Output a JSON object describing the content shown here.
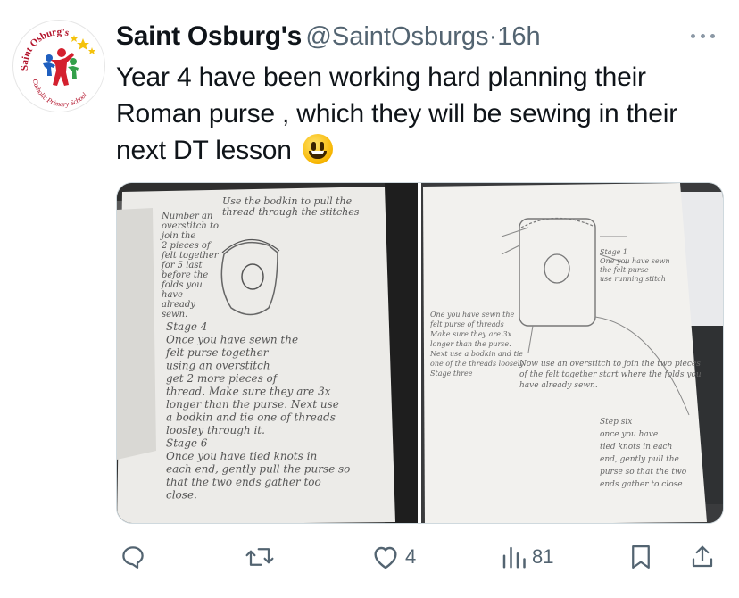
{
  "tweet": {
    "display_name": "Saint Osburg's",
    "handle": "@SaintOsburgs",
    "separator": "·",
    "timestamp": "16h",
    "text": "Year 4 have been working hard planning their Roman purse , which they will be sewing in their next DT lesson",
    "emoji": "grinning-face-emoji"
  },
  "avatar": {
    "logo_text_top": "Saint Osburg's",
    "logo_text_bottom": "Catholic Primary School"
  },
  "actions": {
    "reply_icon": "reply-icon",
    "retweet_icon": "retweet-icon",
    "like_icon": "heart-icon",
    "like_count": "4",
    "views_icon": "views-icon",
    "views_count": "81",
    "bookmark_icon": "bookmark-icon",
    "share_icon": "share-icon"
  },
  "media": {
    "left_photo": {
      "lines": [
        "Use the bodkin to pull the",
        "thread through the stitches",
        "Number an",
        "overstitch to",
        "join the",
        "2 pieces of",
        "felt together",
        "for 5 last",
        "before the",
        "folds you",
        "have",
        "already",
        "sewn.",
        "Stage 4",
        "Once you have sewn the",
        "felt purse together",
        "using an overstitch",
        "get 2 more pieces of",
        "thread. Make sure they are 3x",
        "longer than the purse. Next use",
        "a bodkin and tie one of threads",
        "loosley through it.",
        "Stage 6",
        "Once you have tied knots in",
        "each end, gently pull the purse so",
        "that the two ends gather too",
        "close."
      ]
    },
    "right_photo": {
      "lines": [
        "Stage 1",
        "One you have sewn",
        "the felt purse",
        "use running stitch",
        "One you have sewn the",
        "felt purse of threads",
        "Make sure they are 3x",
        "longer than the purse.",
        "Next use a bodkin and tie",
        "one of the threads loosely",
        "Stage three",
        "Now use an overstitch to join the two pieces",
        "of the felt together start where the folds you",
        "have already sewn.",
        "Step six",
        "once you have",
        "tied knots in each",
        "end, gently pull the",
        "purse so that the two",
        "ends gather to close"
      ]
    }
  },
  "colors": {
    "text_primary": "#0f1419",
    "text_secondary": "#536471",
    "border": "#cfd9de"
  }
}
